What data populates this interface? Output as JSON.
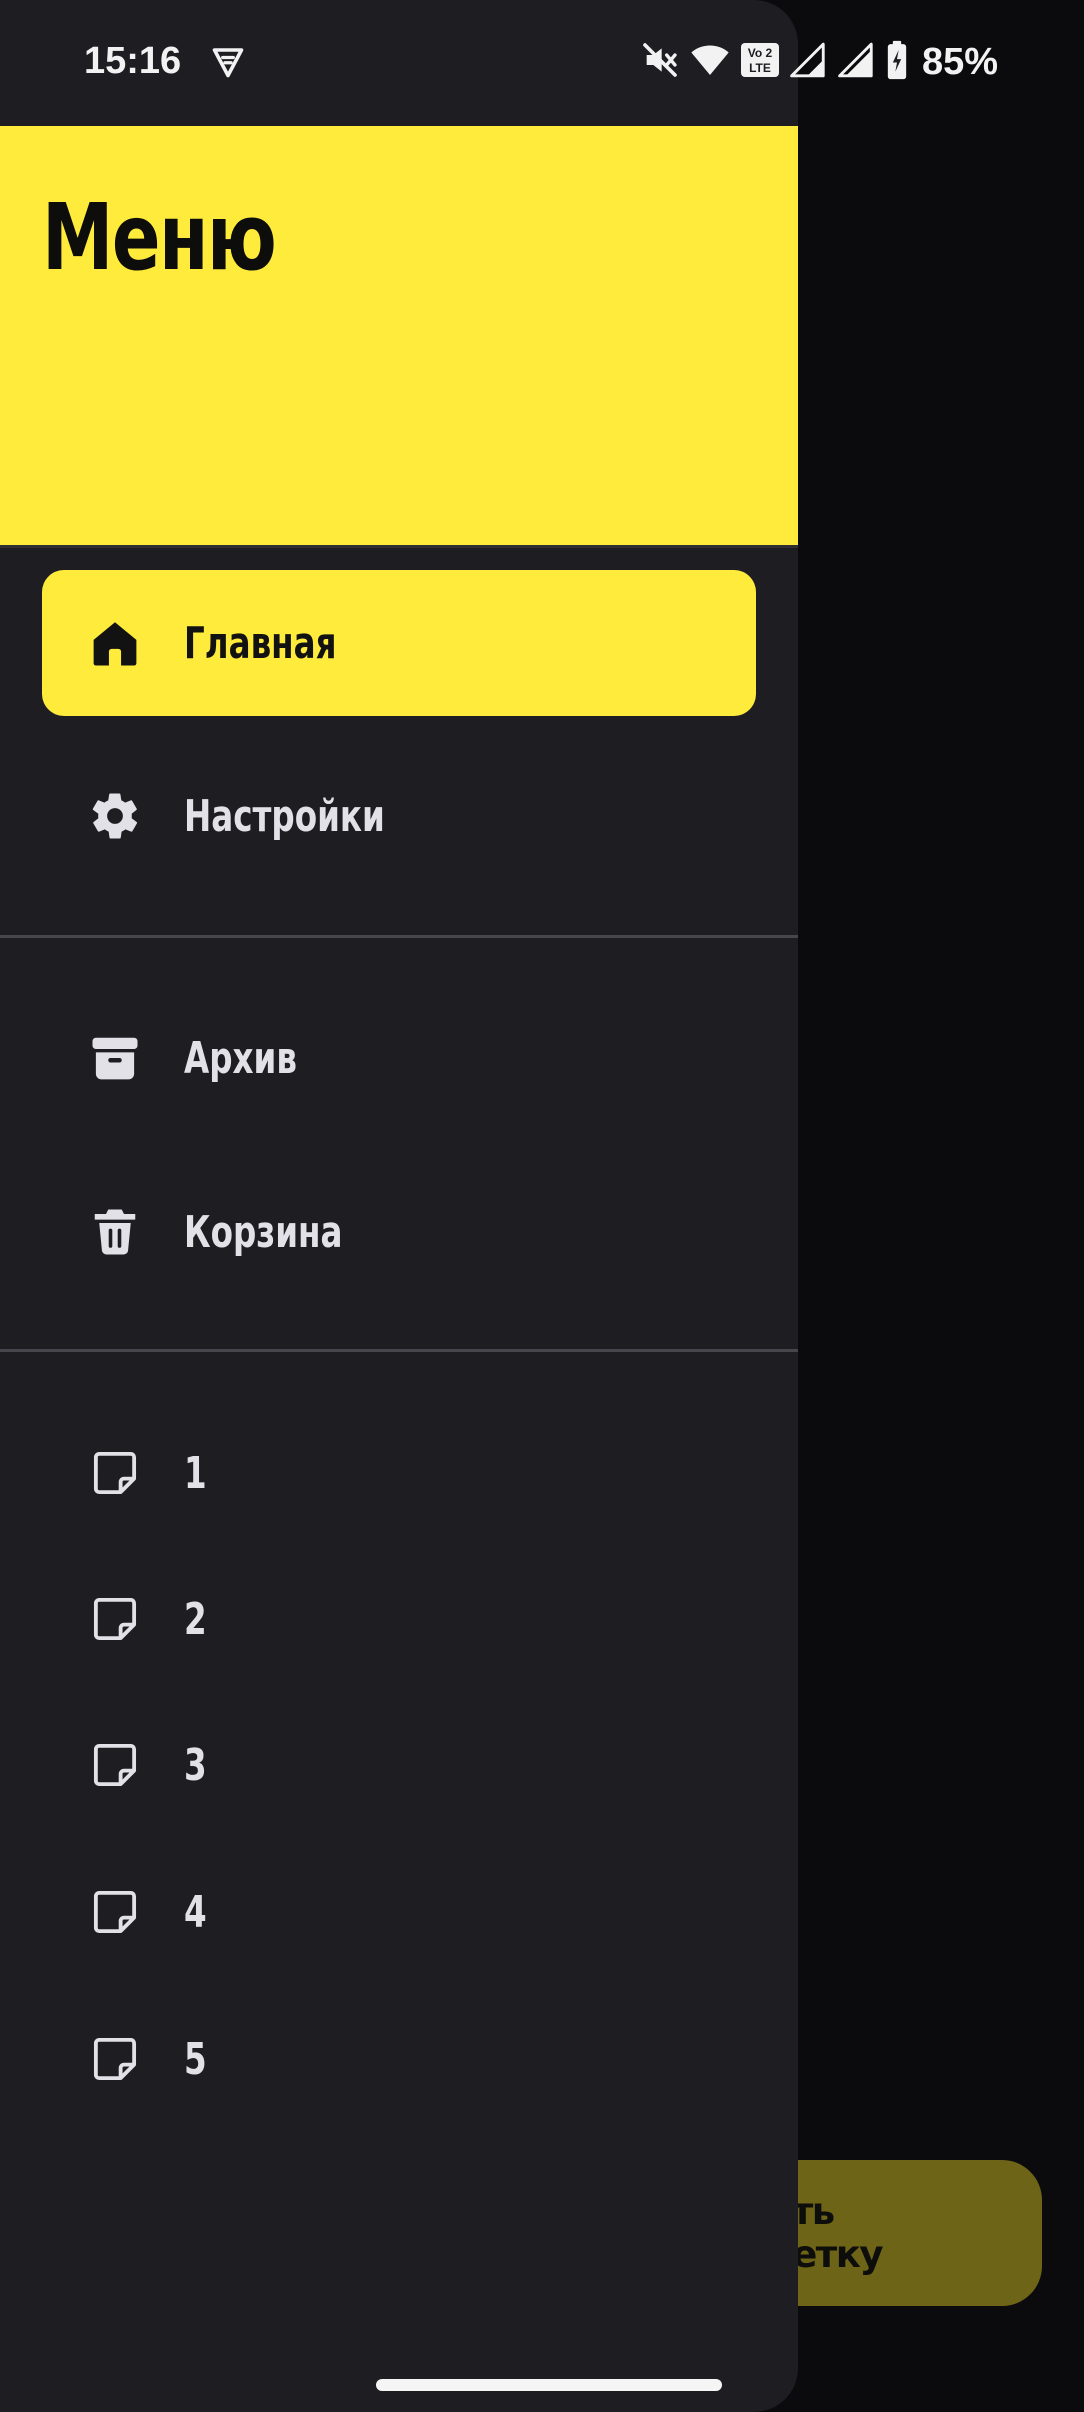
{
  "status_bar": {
    "time": "15:16",
    "battery": "85%",
    "lte_badge_top": "Vo 2",
    "lte_badge_bottom": "LTE",
    "icons": [
      "vpn-icon",
      "mute-icon",
      "wifi-icon",
      "volte-icon",
      "signal-roaming-icon",
      "signal-icon",
      "battery-charging-icon"
    ]
  },
  "drawer": {
    "title": "Меню",
    "primary_items": [
      {
        "label": "Главная",
        "icon": "home-icon",
        "active": true
      },
      {
        "label": "Настройки",
        "icon": "gear-icon",
        "active": false
      }
    ],
    "secondary_items": [
      {
        "label": "Архив",
        "icon": "archive-icon"
      },
      {
        "label": "Корзина",
        "icon": "trash-icon"
      }
    ],
    "notes": [
      {
        "label": "1",
        "icon": "note-icon"
      },
      {
        "label": "2",
        "icon": "note-icon"
      },
      {
        "label": "3",
        "icon": "note-icon"
      },
      {
        "label": "4",
        "icon": "note-icon"
      },
      {
        "label": "5",
        "icon": "note-icon"
      }
    ]
  },
  "fab": {
    "label": "здать заметку"
  },
  "colors": {
    "accent": "#ffeb3b",
    "drawer_bg": "#1e1d22",
    "scrim_bg": "#0b0b0d",
    "fab_dimmed": "#6e6418",
    "text_light": "#e3e1e8"
  }
}
